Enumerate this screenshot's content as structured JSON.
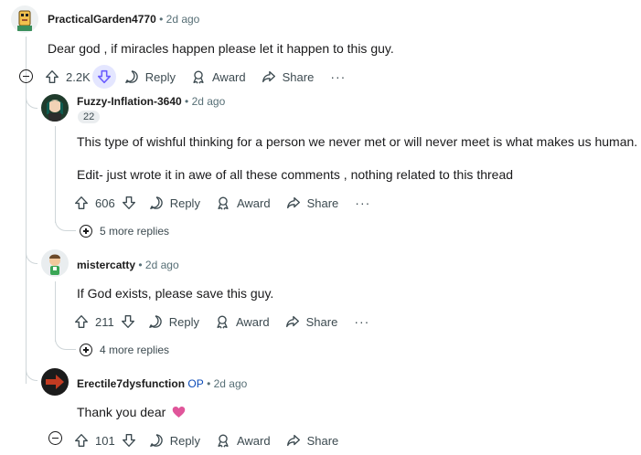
{
  "comments": [
    {
      "author": "PracticalGarden4770",
      "time": "2d ago",
      "text": "Dear god , if miracles happen please let it happen to this guy.",
      "votes": "2.2K",
      "downvote_active": true
    },
    {
      "author": "Fuzzy-Inflation-3640",
      "time": "2d ago",
      "flair": "22",
      "text1": "This type of wishful thinking for a person we never met or will never meet is what makes us human.",
      "text2": "Edit- just wrote it in awe of all these comments , nothing related to this thread",
      "votes": "606",
      "more_replies": "5 more replies"
    },
    {
      "author": "mistercatty",
      "time": "2d ago",
      "text": "If God exists, please save this guy.",
      "votes": "211",
      "more_replies": "4 more replies"
    },
    {
      "author": "Erectile7dysfunction",
      "op": "OP",
      "time": "2d ago",
      "text": "Thank you dear",
      "votes": "101"
    }
  ],
  "labels": {
    "reply": "Reply",
    "award": "Award",
    "share": "Share",
    "more": "···",
    "dot": "•"
  },
  "colors": {
    "downvote_active": "#6a5cff",
    "heart": "#e0559a"
  },
  "icons": [
    "upvote-icon",
    "downvote-icon",
    "comment-icon",
    "award-icon",
    "share-icon",
    "plus-circle-icon",
    "collapse-icon",
    "heart-emoji-icon"
  ]
}
